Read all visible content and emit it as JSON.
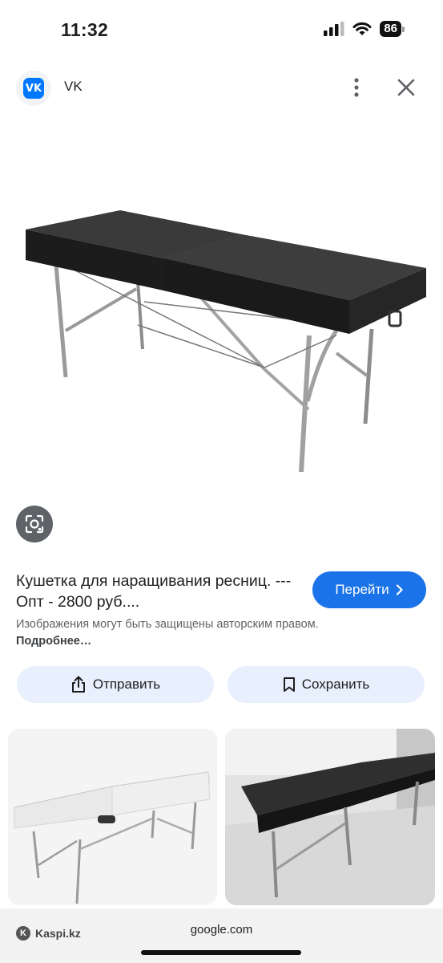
{
  "status": {
    "time": "11:32",
    "battery": "86"
  },
  "source": {
    "name": "VK",
    "logo_text": "VK"
  },
  "result": {
    "title": "Кушетка для наращивания ресниц. --- Опт - 2800 руб....",
    "goto_label": "Перейти",
    "copyright_text": "Изображения могут быть защищены авторским правом.",
    "copyright_link": "Подробнее…"
  },
  "actions": {
    "share_label": "Отправить",
    "save_label": "Сохранить"
  },
  "browser": {
    "site_label": "Kaspi.kz",
    "url": "google.com"
  },
  "colors": {
    "accent": "#1a73e8",
    "chip_bg": "#e8f0fe",
    "vk_blue": "#0077ff"
  },
  "icons": [
    "signal-icon",
    "wifi-icon",
    "battery-icon",
    "vk-logo",
    "more-vert-icon",
    "close-icon",
    "lens-search-icon",
    "chevron-right-icon",
    "share-icon",
    "bookmark-icon"
  ]
}
